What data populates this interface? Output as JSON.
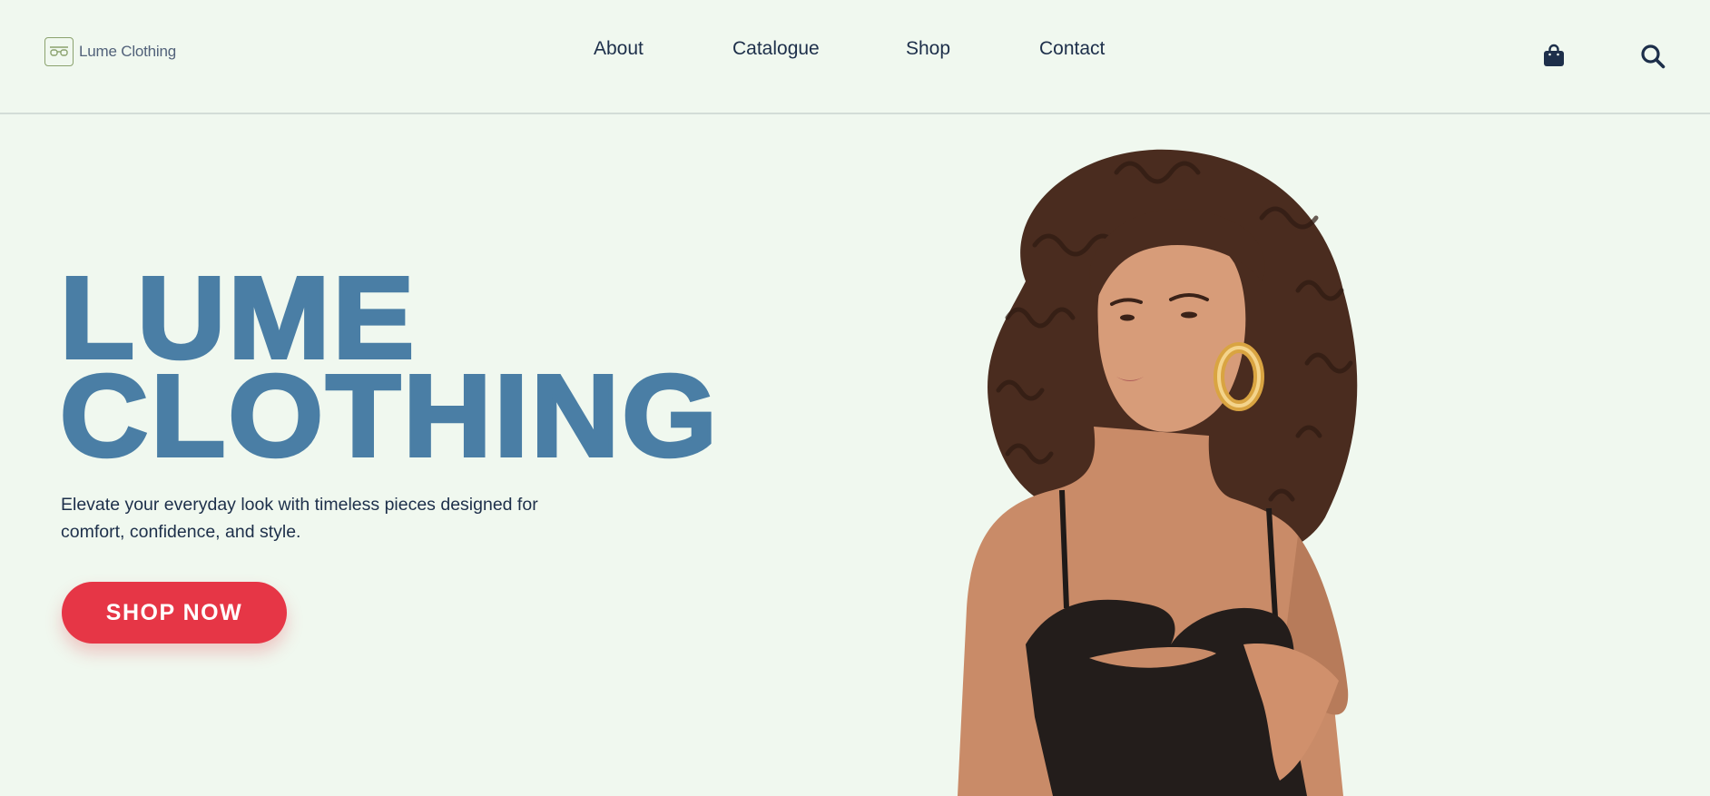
{
  "brand": {
    "name": "Lume Clothing",
    "logo_icon": "glasses-icon",
    "logo_color": "#8ba26e"
  },
  "nav": {
    "items": [
      {
        "label": "About"
      },
      {
        "label": "Catalogue"
      },
      {
        "label": "Shop"
      },
      {
        "label": "Contact"
      }
    ]
  },
  "header_icons": {
    "cart": "shopping-bag-icon",
    "search": "search-icon"
  },
  "hero": {
    "title_line1": "LUME",
    "title_line2": "CLOTHING",
    "subtitle_line1": "Elevate your everyday look with timeless pieces designed for",
    "subtitle_line2": "comfort, confidence, and style.",
    "cta_label": "SHOP NOW"
  },
  "colors": {
    "background": "#f0f8ef",
    "title": "#4a7ea5",
    "text": "#1d2f4a",
    "cta": "#e63646"
  }
}
